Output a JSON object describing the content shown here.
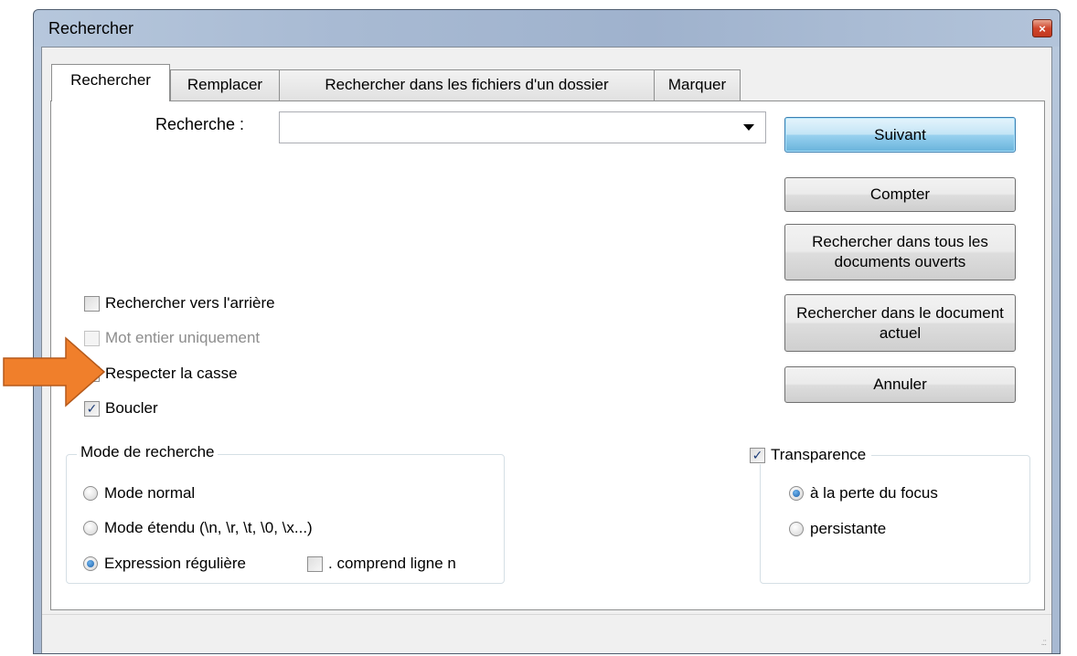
{
  "window": {
    "title": "Rechercher",
    "close_glyph": "×"
  },
  "tabs": [
    {
      "label": "Rechercher",
      "active": true
    },
    {
      "label": "Remplacer",
      "active": false
    },
    {
      "label": "Rechercher dans les fichiers d'un dossier",
      "active": false
    },
    {
      "label": "Marquer",
      "active": false
    }
  ],
  "search": {
    "label": "Recherche :",
    "value": "",
    "placeholder": ""
  },
  "buttons": {
    "next": "Suivant",
    "count": "Compter",
    "find_all_open": "Rechercher dans tous les documents ouverts",
    "find_current": "Rechercher dans le document actuel",
    "cancel": "Annuler"
  },
  "options": {
    "backward": {
      "label": "Rechercher vers l'arrière",
      "checked": false
    },
    "whole_word": {
      "label": "Mot entier uniquement",
      "checked": false,
      "disabled": true
    },
    "match_case": {
      "label": "Respecter la casse",
      "checked": false
    },
    "wrap": {
      "label": "Boucler",
      "checked": true
    }
  },
  "search_mode": {
    "legend": "Mode de recherche",
    "normal": {
      "label": "Mode normal",
      "selected": false
    },
    "extended": {
      "label": "Mode étendu (\\n, \\r, \\t, \\0, \\x...)",
      "selected": false
    },
    "regex": {
      "label": "Expression régulière",
      "selected": true
    },
    "dot_newline": {
      "label": ". comprend ligne n",
      "checked": false
    }
  },
  "transparency": {
    "label": "Transparence",
    "enabled": true,
    "on_focus_loss": {
      "label": "à la perte du focus",
      "selected": true
    },
    "always": {
      "label": "persistante",
      "selected": false
    },
    "level": 0.8
  },
  "annotation": {
    "arrow_color": "#f07f2b",
    "icon": "arrow-right-icon"
  },
  "colors": {
    "default_button": "#98d1ef",
    "check_mark": "#1c3c78"
  },
  "check_glyph": "✓"
}
